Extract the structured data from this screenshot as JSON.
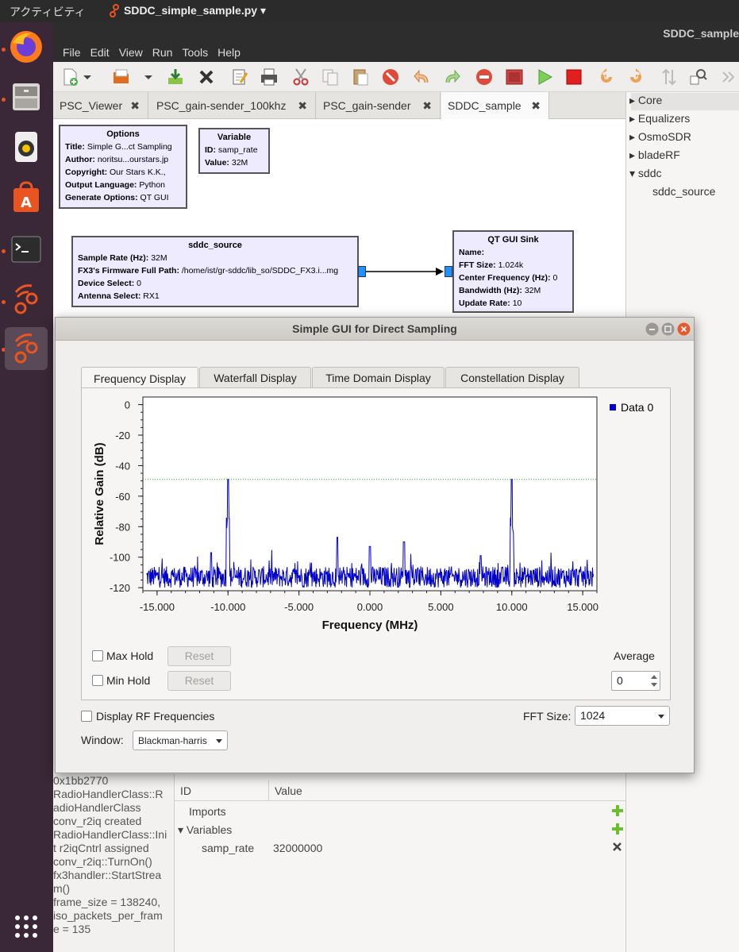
{
  "topbar": {
    "activities": "アクティビティ",
    "app_name": "SDDC_simple_sample.py ▾"
  },
  "window": {
    "title": "SDDC_sample",
    "menu": [
      "File",
      "Edit",
      "View",
      "Run",
      "Tools",
      "Help"
    ]
  },
  "tabs": [
    {
      "label": "PSC_Viewer"
    },
    {
      "label": "PSC_gain-sender_100khz"
    },
    {
      "label": "PSC_gain-sender"
    },
    {
      "label": "SDDC_sample"
    }
  ],
  "blocks": {
    "options": {
      "title": "Options",
      "rows": [
        {
          "k": "Title:",
          "v": "Simple G...ct Sampling"
        },
        {
          "k": "Author:",
          "v": "noritsu...ourstars.jp"
        },
        {
          "k": "Copyright:",
          "v": "Our Stars K.K.,"
        },
        {
          "k": "Output Language:",
          "v": "Python"
        },
        {
          "k": "Generate Options:",
          "v": "QT GUI"
        }
      ]
    },
    "variable": {
      "title": "Variable",
      "rows": [
        {
          "k": "ID:",
          "v": "samp_rate"
        },
        {
          "k": "Value:",
          "v": "32M"
        }
      ]
    },
    "sddc_source": {
      "title": "sddc_source",
      "rows": [
        {
          "k": "Sample Rate (Hz):",
          "v": "32M"
        },
        {
          "k": "FX3's Firmware Full Path:",
          "v": "/home/ist/gr-sddc/lib_so/SDDC_FX3.i...mg"
        },
        {
          "k": "Device Select:",
          "v": "0"
        },
        {
          "k": "Antenna Select:",
          "v": "RX1"
        }
      ]
    },
    "qt_sink": {
      "title": "QT GUI Sink",
      "rows": [
        {
          "k": "Name:",
          "v": ""
        },
        {
          "k": "FFT Size:",
          "v": "1.024k"
        },
        {
          "k": "Center Frequency (Hz):",
          "v": "0"
        },
        {
          "k": "Bandwidth (Hz):",
          "v": "32M"
        },
        {
          "k": "Update Rate:",
          "v": "10"
        }
      ]
    }
  },
  "tree": {
    "items": [
      {
        "label": "Core",
        "expanded": false
      },
      {
        "label": "Equalizers",
        "expanded": false
      },
      {
        "label": "OsmoSDR",
        "expanded": false
      },
      {
        "label": "bladeRF",
        "expanded": false
      },
      {
        "label": "sddc",
        "expanded": true
      }
    ],
    "child": "sddc_source"
  },
  "console": {
    "lines": [
      "0x1bb2770",
      "RadioHandlerClass::R",
      "adioHandlerClass",
      "conv_r2iq created",
      "RadioHandlerClass::Ini",
      "t r2iqCntrl assigned",
      "conv_r2iq::TurnOn()",
      "fx3handler::StartStrea",
      "m()",
      "frame_size = 138240,",
      "iso_packets_per_fram",
      "e = 135"
    ]
  },
  "vars_panel": {
    "col_id": "ID",
    "col_value": "Value",
    "imports": "Imports",
    "variables": "Variables",
    "var_name": "samp_rate",
    "var_value": "32000000"
  },
  "dialog": {
    "title": "Simple GUI for Direct Sampling",
    "tabs": [
      "Frequency Display",
      "Waterfall Display",
      "Time Domain Display",
      "Constellation Display"
    ],
    "max_hold": "Max Hold",
    "min_hold": "Min Hold",
    "reset": "Reset",
    "average_label": "Average",
    "average_value": "0",
    "display_rf": "Display RF Frequencies",
    "fft_size_label": "FFT Size:",
    "fft_size_value": "1024",
    "window_label": "Window:",
    "window_value": "Blackman-harris"
  },
  "colors": {
    "trace": "#0000cc",
    "threshold": "#22aa22",
    "accent": "#e95420"
  },
  "chart_data": {
    "type": "line",
    "xlabel": "Frequency (MHz)",
    "ylabel": "Relative Gain (dB)",
    "xlim": [
      -16,
      16
    ],
    "ylim": [
      -122,
      5
    ],
    "x_ticks": [
      "-15.000",
      "-10.000",
      "-5.000",
      "0.000",
      "5.000",
      "10.000",
      "15.000"
    ],
    "x_tick_values": [
      -15,
      -10,
      -5,
      0,
      5,
      10,
      15
    ],
    "y_ticks": [
      0,
      -20,
      -40,
      -60,
      -80,
      -100,
      -120
    ],
    "legend": "top-right",
    "grid": false,
    "series": [
      {
        "name": "Data 0",
        "noise_floor_db": -113,
        "peaks": [
          {
            "x": -10.0,
            "y": -49
          },
          {
            "x": 10.0,
            "y": -49
          },
          {
            "x": -2.3,
            "y": -87
          },
          {
            "x": 0.0,
            "y": -93
          },
          {
            "x": 2.4,
            "y": -90
          },
          {
            "x": -11.2,
            "y": -97
          },
          {
            "x": 7.8,
            "y": -99
          }
        ]
      }
    ],
    "threshold_db": -49
  }
}
